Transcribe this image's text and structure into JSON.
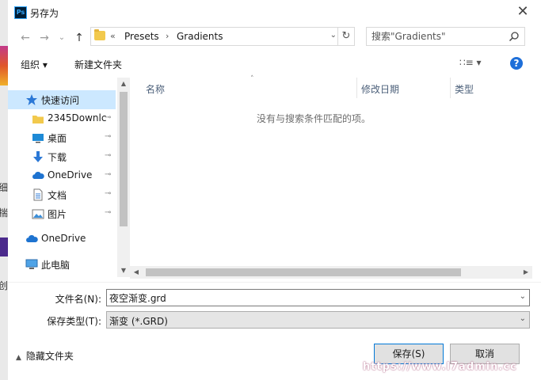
{
  "background": {
    "chars": [
      "细",
      "揣",
      "创"
    ]
  },
  "titlebar": {
    "app_icon": "Ps",
    "title": "另存为",
    "close_glyph": "✕"
  },
  "address": {
    "back_glyph": "←",
    "forward_glyph": "→",
    "history_glyph": "⌄",
    "up_glyph": "↑",
    "overflow": "«",
    "crumbs": [
      "Presets",
      "Gradients"
    ],
    "sep": "›",
    "dropdown_glyph": "⌄",
    "refresh_glyph": "↻"
  },
  "search": {
    "placeholder": "搜索\"Gradients\""
  },
  "toolbar": {
    "organize": "组织 ▾",
    "new_folder": "新建文件夹",
    "view": "∷≡  ▾",
    "help": "?"
  },
  "nav": {
    "pin_glyph": "📌",
    "items": [
      {
        "label": "快速访问",
        "icon": "star-icon",
        "pinned": false
      },
      {
        "label": "2345Downlc",
        "icon": "folder-icon",
        "pinned": true
      },
      {
        "label": "桌面",
        "icon": "desktop-icon",
        "pinned": true
      },
      {
        "label": "下载",
        "icon": "download-icon",
        "pinned": true
      },
      {
        "label": "OneDrive",
        "icon": "onedrive-icon",
        "pinned": true
      },
      {
        "label": "文档",
        "icon": "document-icon",
        "pinned": true
      },
      {
        "label": "图片",
        "icon": "pictures-icon",
        "pinned": true
      },
      {
        "label": "OneDrive",
        "icon": "onedrive-icon",
        "pinned": false
      },
      {
        "label": "此电脑",
        "icon": "computer-icon",
        "pinned": false
      }
    ]
  },
  "filelist": {
    "columns": [
      "名称",
      "修改日期",
      "类型"
    ],
    "sort_glyph": "˄",
    "empty_message": "没有与搜索条件匹配的项。"
  },
  "form": {
    "filename_label": "文件名(N):",
    "filename_value": "夜空渐变.grd",
    "filetype_label": "保存类型(T):",
    "filetype_value": "渐变 (*.GRD)",
    "dropdown_glyph": "⌄"
  },
  "footer": {
    "hide_folders": "隐藏文件夹",
    "hide_caret": "▲",
    "save": "保存(S)",
    "cancel": "取消"
  },
  "watermark": "https://www.l7admin.cc",
  "colors": {
    "selection": "#cce8ff",
    "accent": "#0078d7",
    "help": "#1e6fd9",
    "folder": "#f2c94c"
  }
}
